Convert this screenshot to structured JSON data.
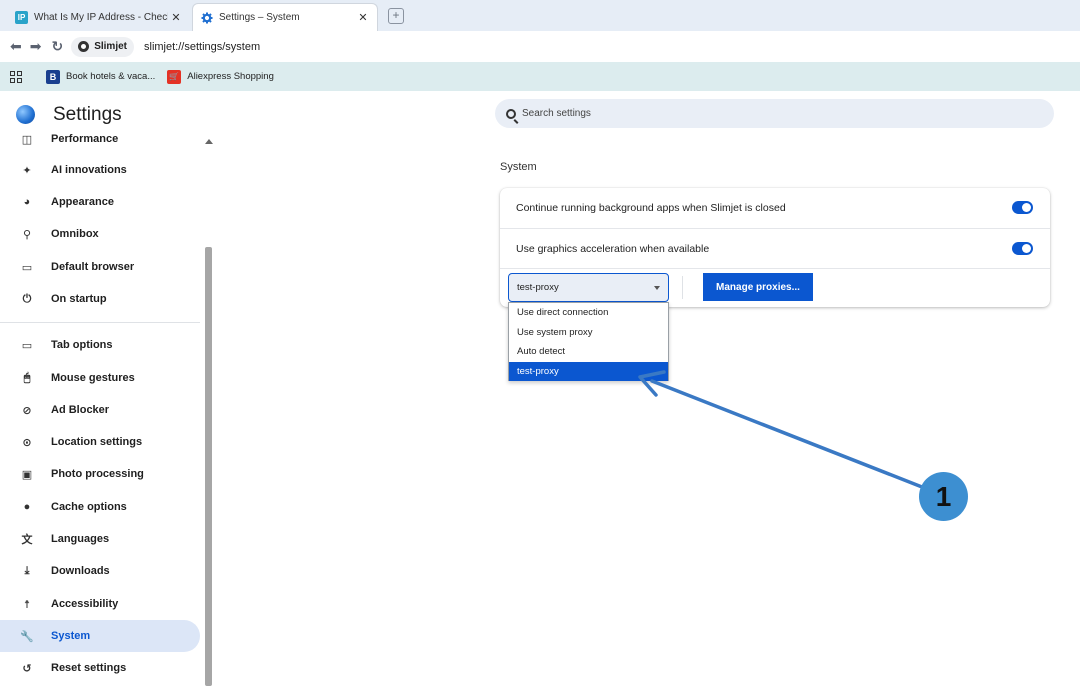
{
  "browser": {
    "tabs": [
      {
        "title": "What Is My IP Address - Check",
        "favicon": "ip-icon",
        "active": false
      },
      {
        "title": "Settings – System",
        "favicon": "gear-icon",
        "active": true
      }
    ],
    "site_chip": "Slimjet",
    "url": "slimjet://settings/system",
    "bookmarks": [
      {
        "label": "Book hotels & vaca...",
        "icon": "booking-icon",
        "color": "#1a3f8f"
      },
      {
        "label": "Aliexpress Shopping",
        "icon": "aliexpress-icon",
        "color": "#e43225"
      }
    ]
  },
  "settings": {
    "title": "Settings",
    "search_placeholder": "Search settings",
    "sidebar": {
      "partial_item": "Performance",
      "items": [
        {
          "label": "AI innovations",
          "icon": "sparkle-icon"
        },
        {
          "label": "Appearance",
          "icon": "palette-icon"
        },
        {
          "label": "Omnibox",
          "icon": "search-icon"
        },
        {
          "label": "Default browser",
          "icon": "browser-window-icon"
        },
        {
          "label": "On startup",
          "icon": "power-icon"
        },
        {
          "label": "Tab options",
          "icon": "tab-icon"
        },
        {
          "label": "Mouse gestures",
          "icon": "mouse-icon"
        },
        {
          "label": "Ad Blocker",
          "icon": "ad-block-icon"
        },
        {
          "label": "Location settings",
          "icon": "location-pin-icon"
        },
        {
          "label": "Photo processing",
          "icon": "photo-icon"
        },
        {
          "label": "Cache options",
          "icon": "cookie-icon"
        },
        {
          "label": "Languages",
          "icon": "translate-icon"
        },
        {
          "label": "Downloads",
          "icon": "download-icon"
        },
        {
          "label": "Accessibility",
          "icon": "accessibility-icon"
        },
        {
          "label": "System",
          "icon": "wrench-icon",
          "selected": true
        },
        {
          "label": "Reset settings",
          "icon": "reset-icon"
        }
      ]
    },
    "section_title": "System",
    "rows": [
      {
        "label": "Continue running background apps when Slimjet is closed",
        "enabled": true
      },
      {
        "label": "Use graphics acceleration when available",
        "enabled": true
      }
    ],
    "proxy": {
      "selected": "test-proxy",
      "options": [
        "Use direct connection",
        "Use system proxy",
        "Auto detect",
        "test-proxy"
      ],
      "manage_label": "Manage proxies..."
    }
  },
  "annotation": {
    "step_number": "1",
    "color": "#3d8fd1"
  }
}
